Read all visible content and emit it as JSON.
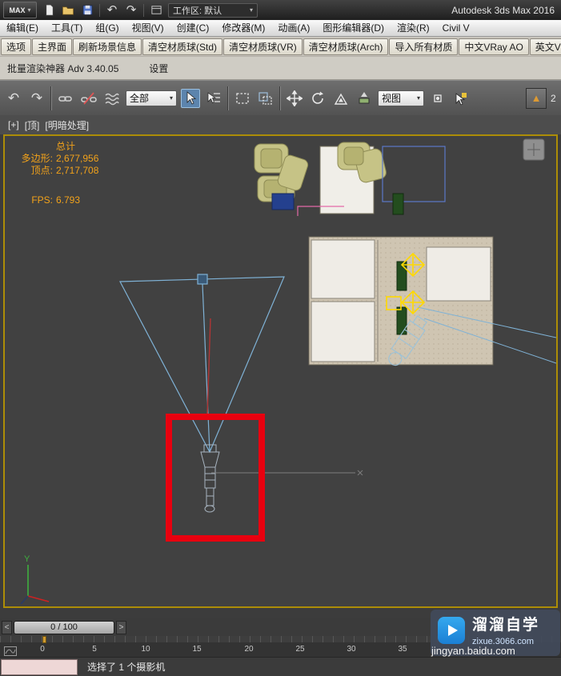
{
  "titlebar": {
    "max_label": "MAX",
    "workspace": "工作区: 默认",
    "app_title": "Autodesk 3ds Max 2016"
  },
  "menus": {
    "items": [
      "编辑(E)",
      "工具(T)",
      "组(G)",
      "视图(V)",
      "创建(C)",
      "修改器(M)",
      "动画(A)",
      "图形编辑器(D)",
      "渲染(R)",
      "Civil V"
    ]
  },
  "plugin_toolbar": {
    "buttons": [
      "选项",
      "主界面",
      "刷新场景信息",
      "清空材质球(Std)",
      "清空材质球(VR)",
      "清空材质球(Arch)",
      "导入所有材质",
      "中文VRay AO",
      "英文VRay A"
    ]
  },
  "batch_bar": {
    "title": "批量渲染神器 Adv 3.40.05",
    "settings": "设置"
  },
  "main_toolbar": {
    "selection_filter": "全部",
    "coord_system": "视图",
    "snap_partial": "2"
  },
  "viewport": {
    "labels": {
      "plus": "[+]",
      "view": "[顶]",
      "shading": "[明暗处理]"
    },
    "stats": {
      "total": "总计",
      "polys_label": "多边形:",
      "polys": "2,677,956",
      "verts_label": "顶点:",
      "verts": "2,717,708",
      "fps_label": "FPS:",
      "fps": "6.793"
    },
    "axis_y": "Y"
  },
  "timeline": {
    "prev": "<",
    "frame": "0 / 100",
    "next": ">",
    "ticks": [
      "0",
      "5",
      "10",
      "15",
      "20",
      "25",
      "30",
      "35"
    ]
  },
  "status": {
    "selection": "选择了 1 个摄影机"
  },
  "watermark": {
    "brand": "溜溜自学",
    "site": "zixue.3066.com",
    "extra": "jingyan.baidu.com"
  },
  "colors": {
    "annotation_red": "#e8000f",
    "stats_orange": "#f2a21a",
    "camera_blue": "#7fb2d6",
    "gizmo_yellow": "#ffd900",
    "active_viewport_border": "#ac8d07"
  }
}
